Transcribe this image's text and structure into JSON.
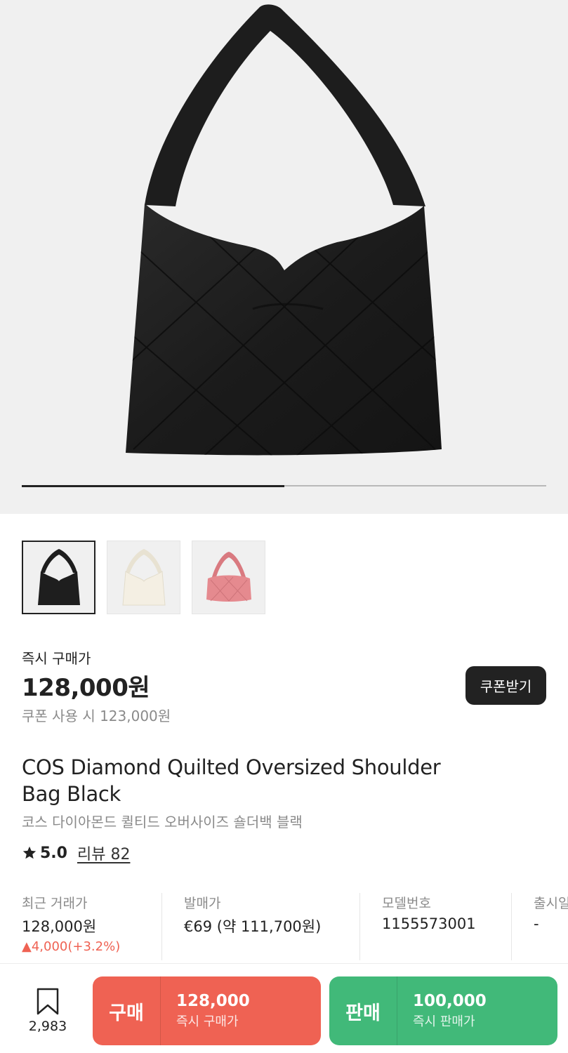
{
  "hero": {
    "image_desc": "black-quilted-shoulder-bag",
    "slide_progress": 0.5
  },
  "thumbnails": [
    {
      "color": "#1e1e1e",
      "selected": true
    },
    {
      "color": "#f1ece0",
      "selected": false
    },
    {
      "color": "#e58a8f",
      "selected": false
    }
  ],
  "price": {
    "label": "즉시 구매가",
    "value": "128,000원",
    "coupon_price": "쿠폰 사용 시 123,000원",
    "coupon_button": "쿠폰받기"
  },
  "product": {
    "title_en": "COS Diamond Quilted Oversized Shoulder Bag Black",
    "title_ko": "코스 다이아몬드 퀼티드 오버사이즈 숄더백 블랙",
    "rating": "5.0",
    "review_label": "리뷰 82"
  },
  "info": [
    {
      "label": "최근 거래가",
      "value": "128,000원",
      "change": "▲4,000(+3.2%)"
    },
    {
      "label": "발매가",
      "value": "€69 (약 111,700원)"
    },
    {
      "label": "모델번호",
      "value": "1155573001"
    },
    {
      "label": "출시일",
      "value": "-"
    }
  ],
  "bottom": {
    "wish_count": "2,983",
    "buy": {
      "kind": "구매",
      "amount": "128,000",
      "sub": "즉시 구매가"
    },
    "sell": {
      "kind": "판매",
      "amount": "100,000",
      "sub": "즉시 판매가"
    }
  },
  "colors": {
    "accent_buy": "#ef6253",
    "accent_sell": "#41b979",
    "dark": "#222222"
  }
}
